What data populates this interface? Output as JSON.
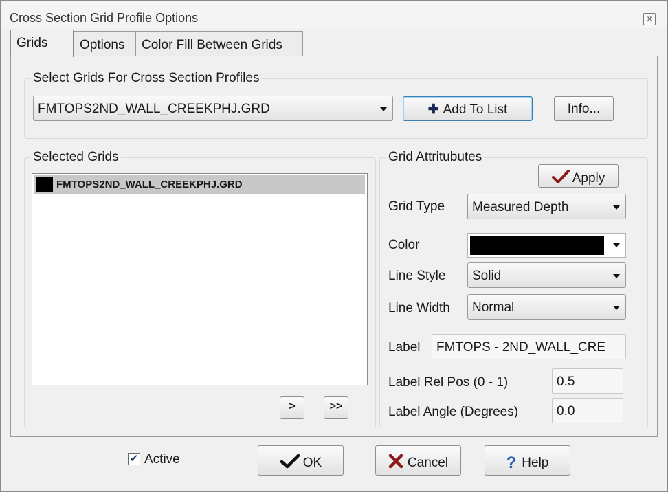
{
  "window": {
    "title": "Cross Section Grid Profile Options",
    "close_symbol": "⊠"
  },
  "tabs": [
    {
      "label": "Grids",
      "active": true
    },
    {
      "label": "Options",
      "active": false
    },
    {
      "label": "Color Fill Between Grids",
      "active": false
    }
  ],
  "select_group": {
    "label": "Select Grids For Cross Section Profiles",
    "grid_value": "FMTOPS2ND_WALL_CREEKPHJ.GRD",
    "add_button": "Add To List",
    "add_icon": "plus-icon",
    "info_button": "Info..."
  },
  "selected_group": {
    "label": "Selected Grids",
    "items": [
      {
        "name": "FMTOPS2ND_WALL_CREEKPHJ.GRD",
        "color": "#000000"
      }
    ],
    "move_one_button": ">",
    "move_all_button": ">>"
  },
  "attributes": {
    "label": "Grid Attritubutes",
    "apply_button": "Apply",
    "apply_icon": "checkmark-icon",
    "grid_type_label": "Grid Type",
    "grid_type_value": "Measured Depth",
    "color_label": "Color",
    "color_value": "#000000",
    "line_style_label": "Line Style",
    "line_style_value": "Solid",
    "line_width_label": "Line Width",
    "line_width_value": "Normal",
    "label_label": "Label",
    "label_value": "FMTOPS - 2ND_WALL_CRE",
    "label_rel_pos_label": "Label Rel Pos (0 - 1)",
    "label_rel_pos_value": "0.5",
    "label_angle_label": "Label Angle (Degrees)",
    "label_angle_value": "0.0"
  },
  "footer": {
    "active_label": "Active",
    "active_checked": true,
    "ok_button": "OK",
    "cancel_button": "Cancel",
    "help_button": "Help",
    "colors": {
      "ok_check": "#111111",
      "cancel_x": "#8b1a1a",
      "help_q": "#2a5db0"
    }
  }
}
